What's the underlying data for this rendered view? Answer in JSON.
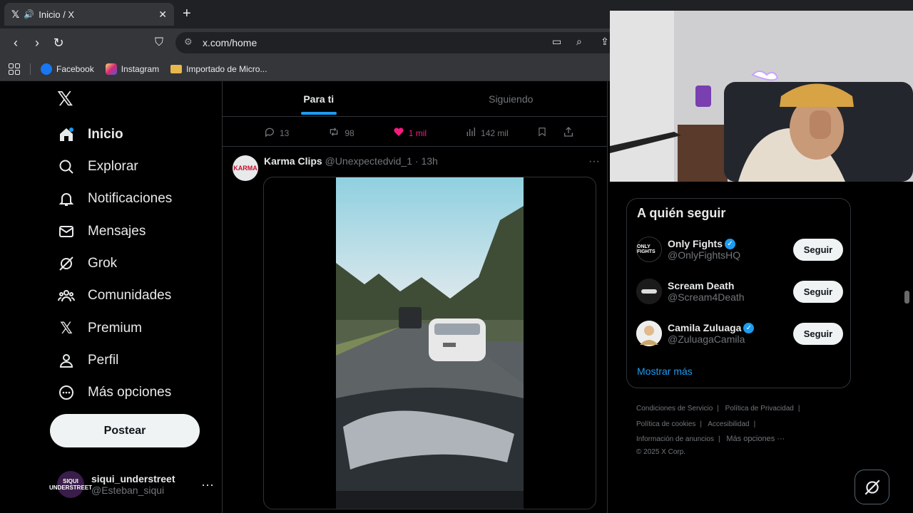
{
  "browser": {
    "tab_title": "Inicio / X",
    "url": "x.com/home",
    "bookmarks": [
      {
        "label": "Facebook",
        "color": "#1877f2"
      },
      {
        "label": "Instagram",
        "color": "#d62976"
      },
      {
        "label": "Importado de Micro...",
        "color": "#e8b84a"
      }
    ]
  },
  "nav": {
    "logo": "𝕏",
    "items": [
      {
        "label": "Inicio",
        "icon": "home-icon"
      },
      {
        "label": "Explorar",
        "icon": "search-icon"
      },
      {
        "label": "Notificaciones",
        "icon": "bell-icon"
      },
      {
        "label": "Mensajes",
        "icon": "envelope-icon"
      },
      {
        "label": "Grok",
        "icon": "grok-icon"
      },
      {
        "label": "Comunidades",
        "icon": "people-icon"
      },
      {
        "label": "Premium",
        "icon": "x-icon"
      },
      {
        "label": "Perfil",
        "icon": "person-icon"
      },
      {
        "label": "Más opciones",
        "icon": "more-circle-icon"
      }
    ],
    "post_label": "Postear"
  },
  "account": {
    "avatar_text": "SIQUI UNDERSTREET",
    "name": "siqui_understreet",
    "handle": "@Esteban_siqui"
  },
  "timeline": {
    "tabs": [
      "Para ti",
      "Siguiendo"
    ],
    "actions": {
      "replies": "13",
      "reposts": "98",
      "likes": "1 mil",
      "views": "142 mil"
    },
    "tweet": {
      "avatar_text": "KARMA",
      "author": "Karma Clips",
      "handle": "@Unexpectedvid_1",
      "time": "· 13h"
    }
  },
  "follow": {
    "title": "A quién seguir",
    "accounts": [
      {
        "avatar_text": "ONLY FIGHTS",
        "name": "Only Fights",
        "handle": "@OnlyFightsHQ",
        "verified": true,
        "button": "Seguir"
      },
      {
        "avatar_text": "",
        "name": "Scream Death",
        "handle": "@Scream4Death",
        "verified": false,
        "button": "Seguir"
      },
      {
        "avatar_text": "",
        "name": "Camila Zuluaga",
        "handle": "@ZuluagaCamila",
        "verified": true,
        "button": "Seguir"
      }
    ],
    "show_more": "Mostrar más"
  },
  "footer": {
    "links": [
      "Condiciones de Servicio",
      "Política de Privacidad",
      "Política de cookies",
      "Accesibilidad",
      "Información de anuncios",
      "Más opciones ···"
    ],
    "copyright": "© 2025 X Corp."
  },
  "colors": {
    "accent": "#1d9bf0",
    "like": "#f91880"
  }
}
